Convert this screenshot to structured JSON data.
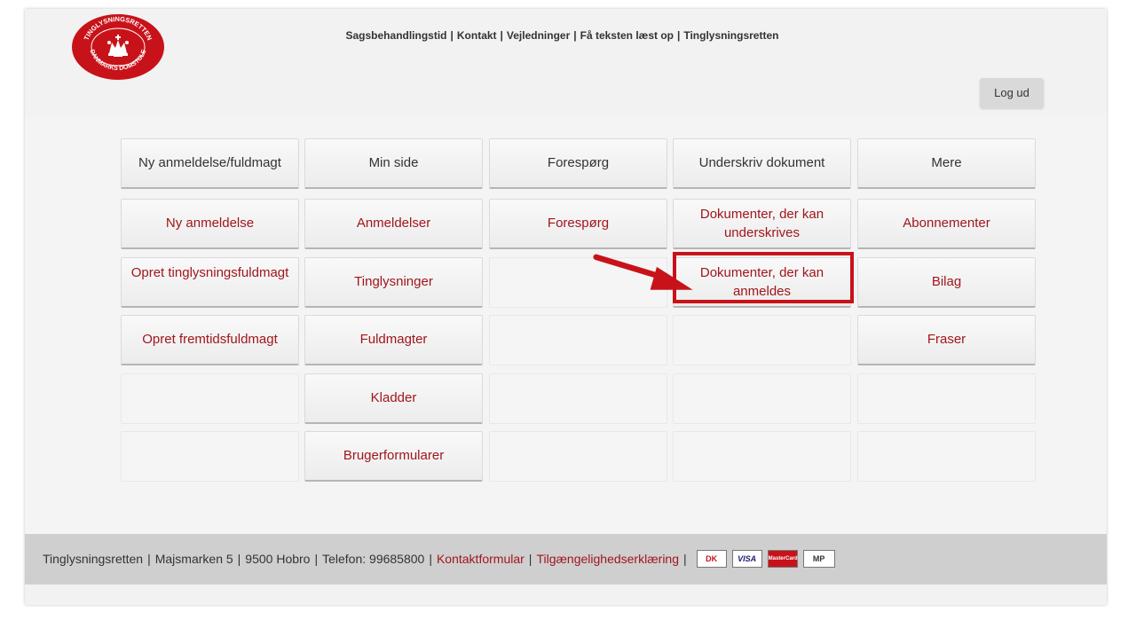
{
  "header": {
    "logo_text_top": "TINGLYSNINGSRETTEN",
    "logo_text_bottom": "DANMARKS DOMSTOLE",
    "nav": [
      {
        "label": "Sagsbehandlingstid"
      },
      {
        "label": "Kontakt"
      },
      {
        "label": "Vejledninger"
      },
      {
        "label": "Få teksten læst op"
      },
      {
        "label": "Tinglysningsretten"
      }
    ],
    "nav_separator": "|",
    "logout_label": "Log ud"
  },
  "menu": {
    "tabs": [
      "Ny anmeldelse/fuldmagt",
      "Min side",
      "Forespørg",
      "Underskriv dokument",
      "Mere"
    ],
    "columns": [
      [
        "Ny anmeldelse",
        "Opret tinglysningsfuldmagt",
        "Opret fremtidsfuldmagt"
      ],
      [
        "Anmeldelser",
        "Tinglysninger",
        "Fuldmagter",
        "Kladder",
        "Brugerformularer"
      ],
      [
        "Forespørg"
      ],
      [
        "Dokumenter, der kan underskrives",
        "Dokumenter, der kan anmeldes"
      ],
      [
        "Abonnementer",
        "Bilag",
        "Fraser"
      ]
    ]
  },
  "footer": {
    "name": "Tinglysningsretten",
    "address": "Majsmarken 5",
    "city": "9500 Hobro",
    "phone": "Telefon: 99685800",
    "contact_link": "Kontaktformular",
    "accessibility_link": "Tilgængelighedserklæring",
    "separator": "|",
    "cards": [
      "DK",
      "VISA",
      "MasterCard",
      "MP"
    ]
  },
  "colors": {
    "accent": "#a0161c",
    "highlight": "#c8121a"
  }
}
